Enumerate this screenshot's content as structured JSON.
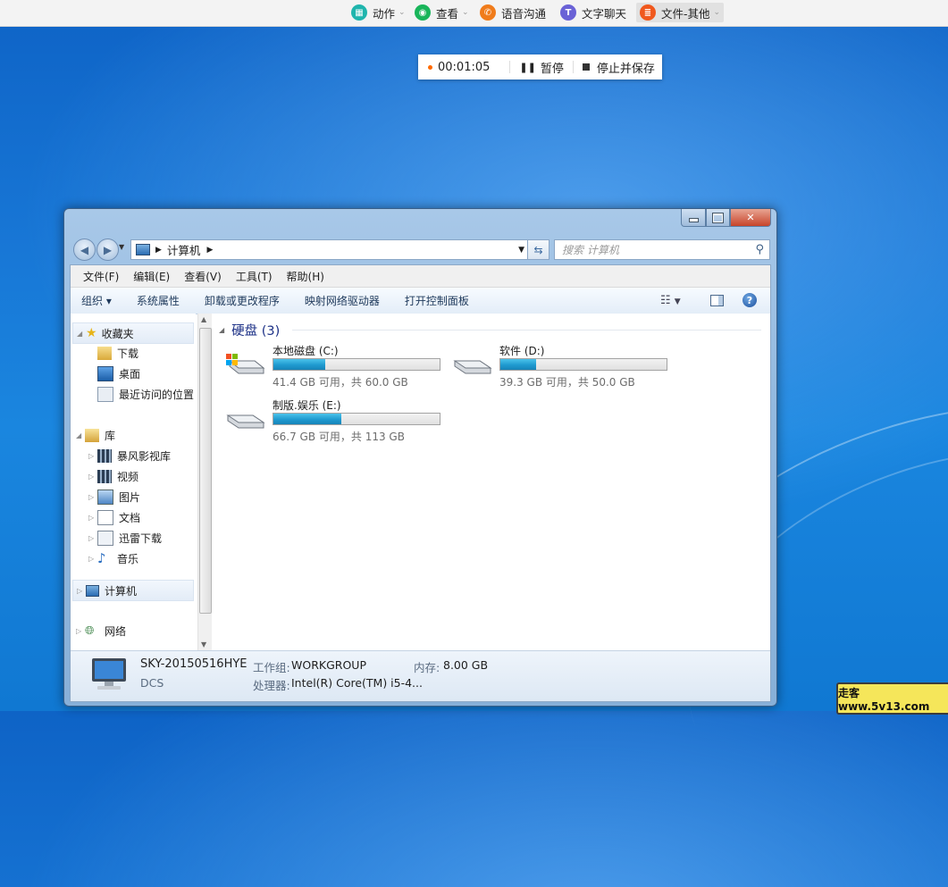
{
  "toolbar": {
    "items": [
      {
        "label": "动作",
        "icon": "action-icon",
        "color": "#1fb5ad",
        "has_dropdown": true
      },
      {
        "label": "查看",
        "icon": "eye-icon",
        "color": "#19b55a",
        "has_dropdown": true
      },
      {
        "label": "语音沟通",
        "icon": "phone-icon",
        "color": "#f07c1b",
        "has_dropdown": false
      },
      {
        "label": "文字聊天",
        "icon": "text-chat-icon",
        "color": "#6a62d6",
        "has_dropdown": false
      },
      {
        "label": "文件-其他",
        "icon": "file-icon",
        "color": "#f0581d",
        "has_dropdown": true
      }
    ],
    "icon_glyphs": [
      "▦",
      "◉",
      "✆",
      "T",
      "≣"
    ]
  },
  "recording": {
    "time": "00:01:05",
    "pause_label": "暂停",
    "stop_label": "停止并保存"
  },
  "explorer": {
    "address_root_icon": "computer-icon",
    "address_path": "计算机",
    "search_placeholder": "搜索 计算机",
    "menu": [
      "文件(F)",
      "编辑(E)",
      "查看(V)",
      "工具(T)",
      "帮助(H)"
    ],
    "commands": [
      "组织 ▾",
      "系统属性",
      "卸载或更改程序",
      "映射网络驱动器",
      "打开控制面板"
    ],
    "nav": {
      "favorites_label": "收藏夹",
      "favorites": [
        "下载",
        "桌面",
        "最近访问的位置"
      ],
      "libraries_label": "库",
      "libraries": [
        "暴风影视库",
        "视频",
        "图片",
        "文档",
        "迅雷下载",
        "音乐"
      ],
      "computer_label": "计算机",
      "network_label": "网络"
    },
    "group_title": "硬盘 (3)",
    "drives": [
      {
        "name": "本地磁盘 (C:)",
        "free_text": "41.4 GB 可用，共 60.0 GB",
        "used_fraction": 0.31,
        "system": true
      },
      {
        "name": "软件 (D:)",
        "free_text": "39.3 GB 可用，共 50.0 GB",
        "used_fraction": 0.214,
        "system": false
      },
      {
        "name": "制版.娱乐 (E:)",
        "free_text": "66.7 GB 可用，共 113 GB",
        "used_fraction": 0.41,
        "system": false
      }
    ],
    "details": {
      "computer_name": "SKY-20150516HYE",
      "domain": "DCS",
      "workgroup_label": "工作组:",
      "workgroup": "WORKGROUP",
      "memory_label": "内存:",
      "memory": "8.00 GB",
      "cpu_label": "处理器:",
      "cpu": "Intel(R) Core(TM) i5-4..."
    }
  },
  "watermark": "走客 www.5v13.com"
}
